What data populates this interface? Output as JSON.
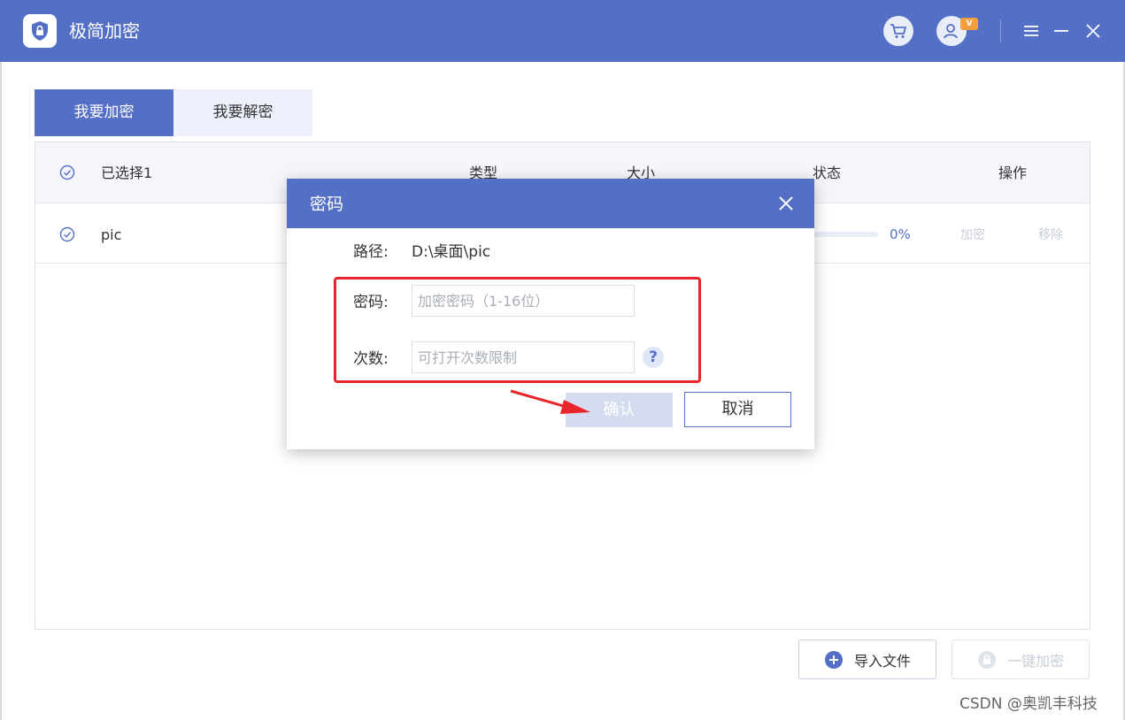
{
  "app": {
    "title": "极简加密"
  },
  "titlebar_icons": [
    "cart-icon",
    "user-icon",
    "menu-icon",
    "minimize-icon",
    "close-icon"
  ],
  "vip_badge": "V",
  "tabs": [
    {
      "label": "我要加密",
      "active": true
    },
    {
      "label": "我要解密",
      "active": false
    }
  ],
  "table": {
    "columns": {
      "selected": "已选择1",
      "type": "类型",
      "size": "大小",
      "status": "状态",
      "actions": "操作"
    },
    "rows": [
      {
        "name": "pic",
        "progress": 0,
        "progress_text": "0%",
        "encrypt_label": "加密",
        "remove_label": "移除"
      }
    ]
  },
  "footer": {
    "import_label": "导入文件",
    "encrypt_all_label": "一键加密"
  },
  "dialog": {
    "title": "密码",
    "path_label": "路径:",
    "path_value": "D:\\桌面\\pic",
    "password_label": "密码:",
    "password_placeholder": "加密密码（1-16位）",
    "count_label": "次数:",
    "count_placeholder": "可打开次数限制",
    "help_symbol": "?",
    "ok_label": "确认",
    "cancel_label": "取消"
  },
  "watermark": "CSDN @奥凯丰科技",
  "colors": {
    "primary": "#5470c6",
    "annotation_red": "#e8262b",
    "disabled_text": "#c8cdd8",
    "badge_orange": "#f2a03c"
  }
}
